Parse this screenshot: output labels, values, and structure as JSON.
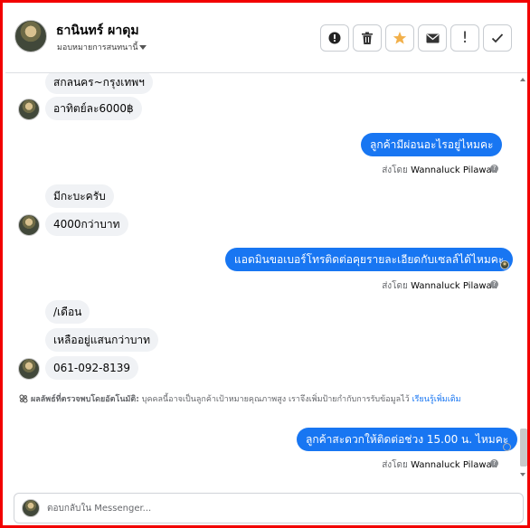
{
  "header": {
    "contact_name": "ธานินทร์ ผาดุม",
    "assign_label": "มอบหมายการสนทนานี้",
    "icons": [
      "alert-circle-icon",
      "trash-icon",
      "star-icon",
      "envelope-icon",
      "exclamation-icon",
      "check-icon"
    ],
    "star_color": "#f2b04a",
    "mark_label": "!"
  },
  "messages": {
    "m1": "สกลนคร~กรุงเทพฯ",
    "m2": "อาทิตย์ละ6000฿",
    "m3": "ลูกค้ามีผ่อนอะไรอยู่ไหมคะ",
    "m4": "มีกะบะครับ",
    "m5": "4000กว่าบาท",
    "m6": "แอดมินขอเบอร์โทรติดต่อคุยรายละเอียดกับเซลล์ได้ไหมคะ",
    "m7": "/เดือน",
    "m8": "เหลืออยู่แสนกว่าบาท",
    "m9": "061-092-8139",
    "m10": "ลูกค้าสะดวกให้ติดต่อช่วง 15.00 น. ไหมคะ"
  },
  "sent_by": {
    "prefix": "ส่งโดย",
    "name": "Wannaluck Pilawan",
    "help_icon": "?"
  },
  "notice": {
    "label": "ผลลัพธ์ที่ตรวจพบโดยอัตโนมัติ:",
    "body": "บุคคลนี้อาจเป็นลูกค้าเป้าหมายคุณภาพสูง เราจึงเพิ่มป้ายกำกับการรับข้อมูลไว้",
    "link": "เรียนรู้เพิ่มเติม"
  },
  "reply": {
    "placeholder": "ตอบกลับใน Messenger..."
  },
  "colors": {
    "outgoing_bubble": "#1876f2",
    "incoming_bubble": "#f0f2f5",
    "frame_border": "#f20000"
  }
}
